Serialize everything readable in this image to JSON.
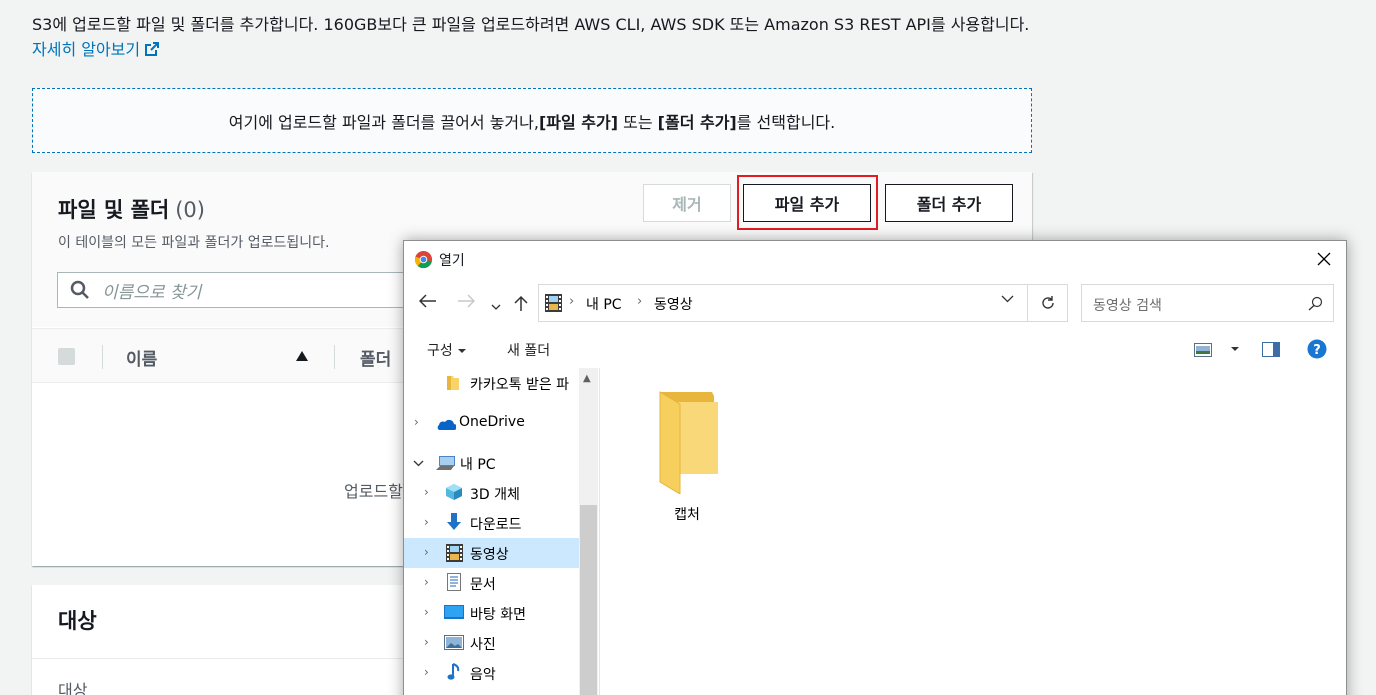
{
  "intro": {
    "text": "S3에 업로드할 파일 및 폴더를 추가합니다. 160GB보다 큰 파일을 업로드하려면 AWS CLI, AWS SDK 또는 Amazon S3 REST API를 사용합니다.",
    "learn_more": "자세히 알아보기"
  },
  "dropzone": {
    "text_before": "여기에 업로드할 파일과 폴더를 끌어서 놓거나, ",
    "add_files": "[파일 추가]",
    "text_middle": " 또는 ",
    "add_folder": "[폴더 추가]",
    "text_after": "를 선택합니다."
  },
  "files_panel": {
    "title": "파일 및 폴더",
    "count": "(0)",
    "description": "이 테이블의 모든 파일과 폴더가 업로드됩니다.",
    "remove_button": "제거",
    "add_files_button": "파일 추가",
    "add_folder_button": "폴더 추가",
    "search_placeholder": "이름으로 찾기",
    "columns": [
      "이름",
      "폴더"
    ],
    "empty_text": "업로드할"
  },
  "destination_panel": {
    "title": "대상",
    "subtitle": "대상"
  },
  "dialog": {
    "title": "열기",
    "breadcrumbs": [
      "내 PC",
      "동영상"
    ],
    "search_placeholder": "동영상 검색",
    "toolbar": {
      "organize": "구성",
      "new_folder": "새 폴더"
    },
    "nav_items": [
      {
        "label": "카카오톡 받은 파",
        "icon": "folder-icon"
      },
      {
        "label": "OneDrive",
        "icon": "onedrive-icon"
      },
      {
        "label": "내 PC",
        "icon": "pc-icon"
      },
      {
        "label": "3D 개체",
        "icon": "3d-objects-icon"
      },
      {
        "label": "다운로드",
        "icon": "download-icon"
      },
      {
        "label": "동영상",
        "icon": "video-icon",
        "selected": true
      },
      {
        "label": "문서",
        "icon": "document-icon"
      },
      {
        "label": "바탕 화면",
        "icon": "desktop-icon"
      },
      {
        "label": "사진",
        "icon": "picture-icon"
      },
      {
        "label": "음악",
        "icon": "music-icon"
      }
    ],
    "files": [
      {
        "label": "캡처",
        "icon": "folder-icon"
      }
    ]
  },
  "colors": {
    "accent": "#0073bb",
    "highlight": "#e31b23",
    "selected": "#cce8ff"
  }
}
